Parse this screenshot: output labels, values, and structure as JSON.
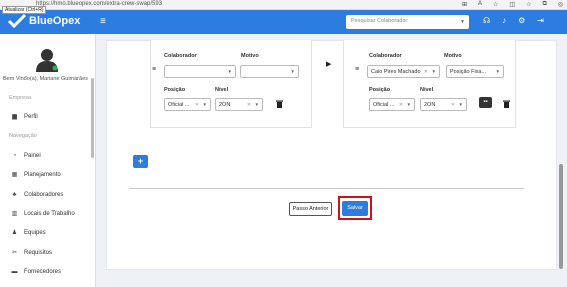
{
  "browser": {
    "url": "https://hmo.blueopex.com/extra-crew-swap/593",
    "tooltip": "Atualizar (Ctrl+R)"
  },
  "header": {
    "logo_text": "BlueOpex",
    "search_placeholder": "Pesquisar Colaborador",
    "icons": [
      "hamburger-icon",
      "headset-icon",
      "bell-icon",
      "gear-icon",
      "logout-icon"
    ]
  },
  "sidebar": {
    "welcome": "Bem Vindo(a), Mariane Guimarães",
    "sections": [
      {
        "title": "Empresa",
        "items": [
          {
            "label": "Perfil",
            "icon": "briefcase-icon"
          }
        ]
      },
      {
        "title": "Navegação",
        "items": [
          {
            "label": "Painel",
            "icon": "dashboard-icon"
          },
          {
            "label": "Planejamento",
            "icon": "calendar-icon"
          },
          {
            "label": "Colaboradores",
            "icon": "users-icon"
          },
          {
            "label": "Locais de Trabalho",
            "icon": "building-icon"
          },
          {
            "label": "Equipes",
            "icon": "team-icon"
          },
          {
            "label": "Requisitos",
            "icon": "tools-icon"
          },
          {
            "label": "Fornecedores",
            "icon": "truck-icon"
          }
        ]
      }
    ]
  },
  "form": {
    "left": {
      "labels": {
        "colaborador": "Colaborador",
        "motivo": "Motivo",
        "posicao": "Posição",
        "nivel": "Nível"
      },
      "colaborador_value": "",
      "motivo_value": "",
      "posicao_value": "Oficial ...",
      "nivel_value": "2ON"
    },
    "right": {
      "labels": {
        "colaborador": "Colaborador",
        "motivo": "Motivo",
        "posicao": "Posição",
        "nivel": "Nível"
      },
      "colaborador_value": "Caio Pires Machado",
      "motivo_value": "Posição Fixa...",
      "posicao_value": "Oficial ...",
      "nivel_value": "2ON"
    },
    "add_label": "+",
    "prev_label": "Passo Anterior",
    "save_label": "Salvar"
  },
  "colors": {
    "brand": "#2d7de0",
    "highlight": "#d0101a"
  }
}
